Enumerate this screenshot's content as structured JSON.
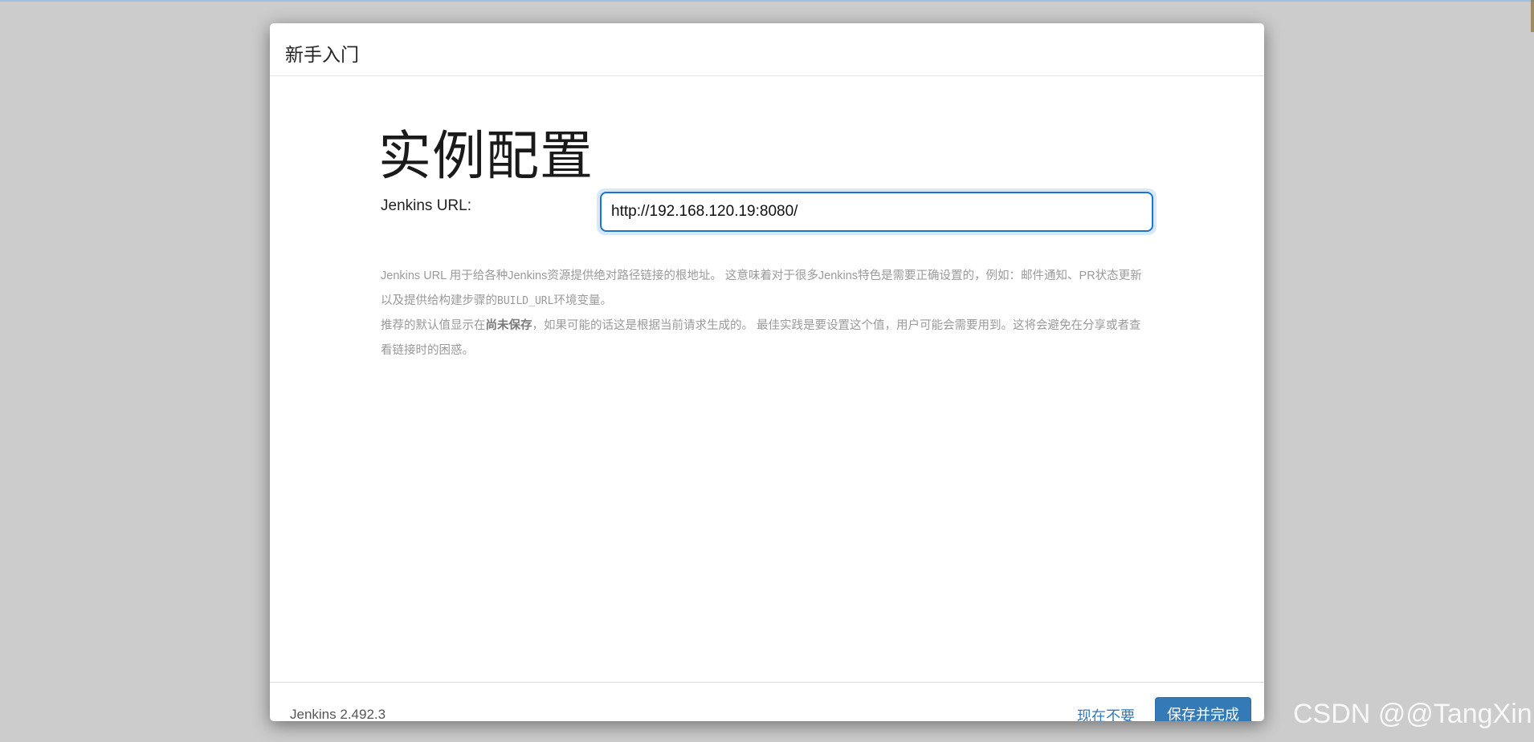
{
  "dialog": {
    "title": "新手入门",
    "heading": "实例配置",
    "url_label": "Jenkins URL:",
    "url_value": "http://192.168.120.19:8080/",
    "help": {
      "p1_a": "Jenkins URL 用于给各种Jenkins资源提供绝对路径链接的根地址。 这意味着对于很多Jenkins特色是需要正确设置的，例如：邮件通知、PR状态更新以及提供给构建步骤的",
      "p1_code": "BUILD_URL",
      "p1_b": "环境变量。",
      "p2_a": "推荐的默认值显示在",
      "p2_bold": "尚未保存",
      "p2_b": "，如果可能的话这是根据当前请求生成的。 最佳实践是要设置这个值，用户可能会需要用到。这将会避免在分享或者查看链接时的困惑。"
    }
  },
  "footer": {
    "version": "Jenkins 2.492.3",
    "skip_label": "现在不要",
    "save_label": "保存并完成"
  },
  "watermark": "CSDN @@TangXin",
  "colors": {
    "backdrop": "#cccccc",
    "primary": "#337ab7",
    "input_focus": "#1b75d0"
  }
}
